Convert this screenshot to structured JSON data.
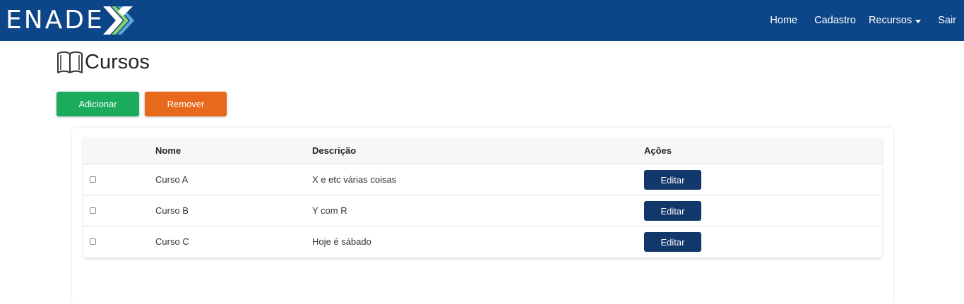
{
  "brand": {
    "name": "ENADE"
  },
  "nav": {
    "home": "Home",
    "cadastro": "Cadastro",
    "recursos": "Recursos",
    "sair": "Sair"
  },
  "page": {
    "title": "Cursos"
  },
  "actions": {
    "add_label": "Adicionar",
    "remove_label": "Remover"
  },
  "table": {
    "headers": {
      "nome": "Nome",
      "descricao": "Descrição",
      "acoes": "Ações"
    },
    "rows": [
      {
        "nome": "Curso A",
        "descricao": "X e etc várias coisas",
        "action": "Editar"
      },
      {
        "nome": "Curso B",
        "descricao": "Y com R",
        "action": "Editar"
      },
      {
        "nome": "Curso C",
        "descricao": "Hoje é sábado",
        "action": "Editar"
      }
    ]
  },
  "colors": {
    "navbar": "#0d4688",
    "add_button": "#1aab5c",
    "remove_button": "#e7691c",
    "edit_button": "#12376b"
  }
}
